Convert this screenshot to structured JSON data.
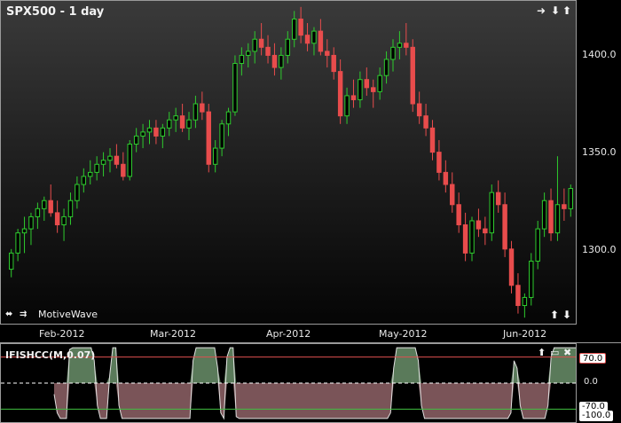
{
  "chart": {
    "symbol_title": "SPX500 - 1 day",
    "brand": "MotiveWave",
    "price_ticks": [
      "1400.0",
      "1350.0",
      "1300.0"
    ],
    "time_ticks": [
      "Feb-2012",
      "Mar-2012",
      "Apr-2012",
      "May-2012",
      "Jun-2012"
    ],
    "icons": {
      "top_right": [
        "arrow-right-icon",
        "arrow-down-icon",
        "arrow-up-icon"
      ],
      "bottom_left": [
        "pan-horizontal-icon",
        "zoom-in-icon"
      ],
      "bottom_right": [
        "arrow-up-icon",
        "arrow-down-icon"
      ],
      "osc_panel": [
        "arrow-up-icon",
        "maximize-icon",
        "close-icon"
      ]
    },
    "colors": {
      "up": "#2ecc2e",
      "down": "#e84c4c",
      "osc_up_fill": "#5a7a5a",
      "osc_down_fill": "#7a5458",
      "upper_line": "#e05050",
      "lower_line": "#40c040"
    }
  },
  "indicator": {
    "title": "IFISHCC(M,0.07)",
    "upper_label": "70.0",
    "zero_label": "0.0",
    "lower_label": "-70.0",
    "min_label": "-100.0"
  },
  "chart_data": {
    "type": "candlestick",
    "title": "SPX500 - 1 day",
    "ylim": [
      1265,
      1425
    ],
    "x": [
      "Feb-2012",
      "Mar-2012",
      "Apr-2012",
      "May-2012",
      "Jun-2012"
    ],
    "ohlc": [
      [
        1292,
        1302,
        1288,
        1300
      ],
      [
        1300,
        1312,
        1296,
        1310
      ],
      [
        1310,
        1318,
        1300,
        1312
      ],
      [
        1312,
        1320,
        1304,
        1318
      ],
      [
        1318,
        1325,
        1312,
        1322
      ],
      [
        1322,
        1328,
        1316,
        1326
      ],
      [
        1326,
        1334,
        1318,
        1320
      ],
      [
        1320,
        1326,
        1310,
        1314
      ],
      [
        1314,
        1322,
        1306,
        1318
      ],
      [
        1318,
        1330,
        1314,
        1326
      ],
      [
        1326,
        1338,
        1322,
        1334
      ],
      [
        1334,
        1342,
        1330,
        1338
      ],
      [
        1338,
        1346,
        1334,
        1340
      ],
      [
        1340,
        1348,
        1336,
        1344
      ],
      [
        1344,
        1350,
        1338,
        1346
      ],
      [
        1346,
        1352,
        1340,
        1348
      ],
      [
        1348,
        1354,
        1342,
        1344
      ],
      [
        1344,
        1350,
        1336,
        1338
      ],
      [
        1338,
        1356,
        1336,
        1354
      ],
      [
        1354,
        1362,
        1350,
        1358
      ],
      [
        1358,
        1364,
        1352,
        1360
      ],
      [
        1360,
        1366,
        1354,
        1362
      ],
      [
        1362,
        1366,
        1354,
        1358
      ],
      [
        1358,
        1364,
        1352,
        1362
      ],
      [
        1362,
        1370,
        1358,
        1366
      ],
      [
        1366,
        1372,
        1360,
        1368
      ],
      [
        1368,
        1374,
        1360,
        1362
      ],
      [
        1362,
        1370,
        1356,
        1366
      ],
      [
        1366,
        1378,
        1362,
        1374
      ],
      [
        1374,
        1380,
        1366,
        1370
      ],
      [
        1370,
        1374,
        1340,
        1344
      ],
      [
        1344,
        1356,
        1340,
        1352
      ],
      [
        1352,
        1366,
        1348,
        1364
      ],
      [
        1364,
        1372,
        1358,
        1370
      ],
      [
        1370,
        1398,
        1368,
        1394
      ],
      [
        1394,
        1402,
        1388,
        1398
      ],
      [
        1398,
        1404,
        1392,
        1400
      ],
      [
        1400,
        1410,
        1394,
        1406
      ],
      [
        1406,
        1414,
        1398,
        1402
      ],
      [
        1402,
        1408,
        1394,
        1398
      ],
      [
        1398,
        1404,
        1388,
        1392
      ],
      [
        1392,
        1402,
        1386,
        1398
      ],
      [
        1398,
        1410,
        1394,
        1406
      ],
      [
        1406,
        1420,
        1402,
        1416
      ],
      [
        1416,
        1422,
        1404,
        1408
      ],
      [
        1408,
        1414,
        1400,
        1404
      ],
      [
        1404,
        1412,
        1398,
        1410
      ],
      [
        1410,
        1416,
        1398,
        1400
      ],
      [
        1400,
        1406,
        1392,
        1398
      ],
      [
        1398,
        1402,
        1386,
        1390
      ],
      [
        1390,
        1396,
        1364,
        1368
      ],
      [
        1368,
        1382,
        1364,
        1378
      ],
      [
        1378,
        1386,
        1372,
        1376
      ],
      [
        1376,
        1390,
        1372,
        1386
      ],
      [
        1386,
        1392,
        1378,
        1382
      ],
      [
        1382,
        1386,
        1372,
        1380
      ],
      [
        1380,
        1392,
        1376,
        1388
      ],
      [
        1388,
        1400,
        1384,
        1396
      ],
      [
        1396,
        1406,
        1390,
        1402
      ],
      [
        1402,
        1410,
        1396,
        1404
      ],
      [
        1404,
        1414,
        1398,
        1402
      ],
      [
        1402,
        1406,
        1370,
        1374
      ],
      [
        1374,
        1380,
        1364,
        1368
      ],
      [
        1368,
        1374,
        1358,
        1362
      ],
      [
        1362,
        1366,
        1346,
        1350
      ],
      [
        1350,
        1356,
        1336,
        1340
      ],
      [
        1340,
        1346,
        1330,
        1334
      ],
      [
        1334,
        1340,
        1320,
        1324
      ],
      [
        1324,
        1330,
        1310,
        1314
      ],
      [
        1314,
        1320,
        1296,
        1300
      ],
      [
        1300,
        1318,
        1296,
        1316
      ],
      [
        1316,
        1322,
        1308,
        1312
      ],
      [
        1312,
        1318,
        1304,
        1310
      ],
      [
        1310,
        1334,
        1306,
        1330
      ],
      [
        1330,
        1336,
        1320,
        1324
      ],
      [
        1324,
        1330,
        1298,
        1302
      ],
      [
        1302,
        1306,
        1280,
        1284
      ],
      [
        1284,
        1290,
        1270,
        1274
      ],
      [
        1274,
        1280,
        1268,
        1278
      ],
      [
        1278,
        1300,
        1274,
        1296
      ],
      [
        1296,
        1316,
        1292,
        1312
      ],
      [
        1312,
        1330,
        1308,
        1326
      ],
      [
        1326,
        1332,
        1306,
        1310
      ],
      [
        1310,
        1348,
        1306,
        1324
      ],
      [
        1324,
        1332,
        1316,
        1322
      ],
      [
        1322,
        1334,
        1318,
        1332
      ]
    ],
    "oscillator": {
      "ylim": [
        -100,
        100
      ],
      "levels": [
        70,
        0,
        -70
      ],
      "values": [
        -30,
        -80,
        -95,
        -95,
        -95,
        90,
        95,
        95,
        95,
        95,
        95,
        95,
        95,
        60,
        -60,
        -95,
        -95,
        -95,
        20,
        95,
        95,
        -60,
        -95,
        -95,
        -95,
        -95,
        -95,
        -95,
        -95,
        -95,
        -95,
        -95,
        -95,
        -95,
        -95,
        -95,
        -95,
        -95,
        -95,
        -95,
        -95,
        -95,
        -95,
        -95,
        -95,
        60,
        95,
        95,
        95,
        95,
        95,
        95,
        95,
        40,
        -80,
        -95,
        70,
        95,
        95,
        -90,
        -95,
        -95,
        -95,
        -95,
        -95,
        -95,
        -95,
        -95,
        -95,
        -95,
        -95,
        -95,
        -95,
        -95,
        -95,
        -95,
        -95,
        -95,
        -95,
        -95,
        -95,
        -95,
        -95,
        -95,
        -95,
        -95,
        -95,
        -95,
        -95,
        -95,
        -95,
        -95,
        -95,
        -95,
        -95,
        -95,
        -95,
        -95,
        -95,
        -95,
        -95,
        -95,
        -95,
        -95,
        -95,
        -95,
        -95,
        -95,
        -95,
        -80,
        40,
        95,
        95,
        95,
        95,
        95,
        95,
        95,
        60,
        -60,
        -95,
        -95,
        -95,
        -95,
        -95,
        -95,
        -95,
        -95,
        -95,
        -95,
        -95,
        -95,
        -95,
        -95,
        -95,
        -95,
        -95,
        -95,
        -95,
        -95,
        -95,
        -95,
        -95,
        -95,
        -95,
        -95,
        -95,
        -95,
        -80,
        60,
        40,
        -60,
        -95,
        -95,
        -95,
        -95,
        -95,
        -95,
        -95,
        -95,
        -60,
        70,
        95,
        95,
        95,
        95,
        95,
        95,
        95,
        95
      ]
    }
  }
}
